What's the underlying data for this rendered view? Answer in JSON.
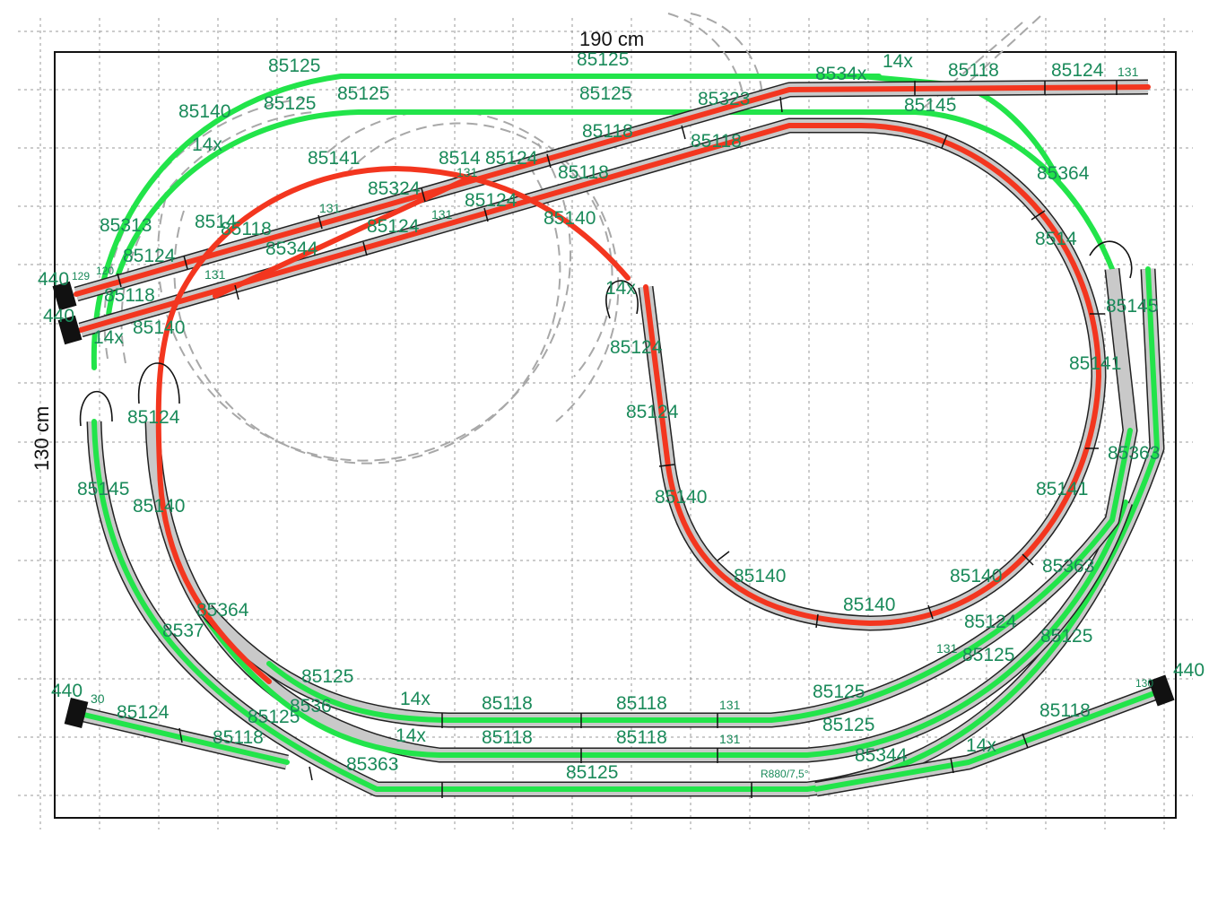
{
  "dimensions": {
    "width": "190 cm",
    "height": "130 cm"
  },
  "labels": [
    "85125",
    "85125",
    "85140",
    "85125",
    "85125",
    "85125",
    "14x",
    "8534x",
    "14x",
    "85118",
    "85124",
    "131",
    "85323",
    "85145",
    "85118",
    "85118",
    "85141",
    "8514",
    "85124",
    "85118",
    "131",
    "85324",
    "131",
    "85364",
    "85313",
    "8514",
    "85118",
    "85124",
    "131",
    "85124",
    "85140",
    "85344",
    "131",
    "85124",
    "129",
    "120",
    "85118",
    "440",
    "440",
    "85140",
    "85124",
    "14x",
    "8514",
    "85145",
    "85124",
    "85124",
    "85141",
    "85145",
    "85140",
    "85140",
    "85363",
    "85140",
    "85141",
    "85140",
    "85140",
    "85364",
    "8537",
    "85363",
    "85124",
    "85125",
    "131",
    "85125",
    "85125",
    "14x",
    "85118",
    "85118",
    "131",
    "85125",
    "85125",
    "440",
    "30",
    "85124",
    "85118",
    "85125",
    "85363",
    "14x",
    "85118",
    "85118",
    "131",
    "85125",
    "85344",
    "14x",
    "85118",
    "85125",
    "85125",
    "8536",
    "R880/7,5°",
    "440",
    "130",
    "14x"
  ]
}
